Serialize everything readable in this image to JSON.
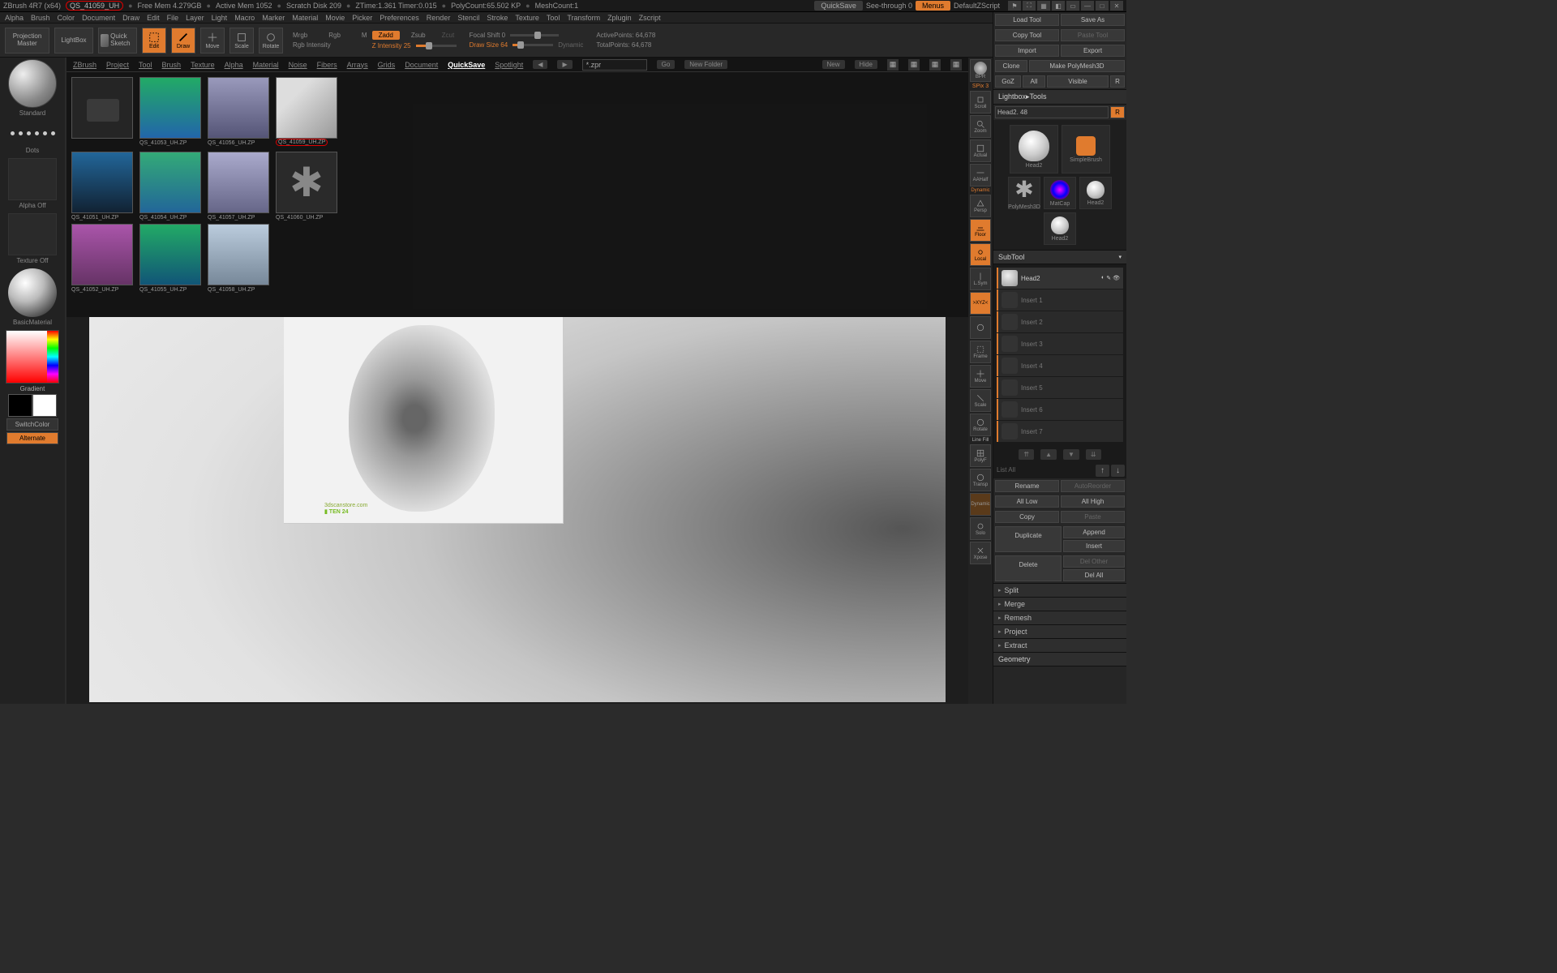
{
  "titlebar": {
    "app": "ZBrush 4R7 (x64)",
    "file": "QS_41059_UH",
    "freemem": "Free Mem 4.279GB",
    "activemem": "Active Mem 1052",
    "scratch": "Scratch Disk 209",
    "ztime": "ZTime:1.361 Timer:0.015",
    "polycount": "PolyCount:65.502 KP",
    "meshcount": "MeshCount:1",
    "quicksave": "QuickSave",
    "seethrough": "See-through   0",
    "menus": "Menus",
    "script": "DefaultZScript"
  },
  "topmenu": [
    "Alpha",
    "Brush",
    "Color",
    "Document",
    "Draw",
    "Edit",
    "File",
    "Layer",
    "Light",
    "Macro",
    "Marker",
    "Material",
    "Movie",
    "Picker",
    "Preferences",
    "Render",
    "Stencil",
    "Stroke",
    "Texture",
    "Tool",
    "Transform",
    "Zplugin",
    "Zscript"
  ],
  "toolbar": {
    "projection": "Projection Master",
    "lightbox": "LightBox",
    "quicksketch": "Quick Sketch",
    "edit": "Edit",
    "draw": "Draw",
    "move": "Move",
    "scale": "Scale",
    "rotate": "Rotate",
    "mrgb": "Mrgb",
    "rgb": "Rgb",
    "m": "M",
    "rgbintensity": "Rgb Intensity",
    "zadd": "Zadd",
    "zsub": "Zsub",
    "zcut": "Zcut",
    "zintensity": "Z Intensity 25",
    "focal": "Focal Shift 0",
    "drawsize": "Draw Size 64",
    "dynamic": "Dynamic",
    "activepoints": "ActivePoints: 64,678",
    "totalpoints": "TotalPoints: 64,678"
  },
  "leftrail": {
    "standard": "Standard",
    "dots": "Dots",
    "alpha": "Alpha Off",
    "texture": "Texture Off",
    "material": "BasicMaterial",
    "gradient": "Gradient",
    "switchcolor": "SwitchColor",
    "alternate": "Alternate"
  },
  "browser": {
    "tabs": [
      "ZBrush",
      "Project",
      "Tool",
      "Brush",
      "Texture",
      "Alpha",
      "Material",
      "Noise",
      "Fibers",
      "Arrays",
      "Grids",
      "Document",
      "QuickSave",
      "Spotlight"
    ],
    "active": "QuickSave",
    "search": "*.zpr",
    "go": "Go",
    "newfolder": "New Folder",
    "new": "New",
    "hide": "Hide",
    "thumbs": [
      {
        "label": "",
        "kind": "folder"
      },
      {
        "label": "QS_41053_UH.ZP",
        "kind": "body1"
      },
      {
        "label": "QS_41056_UH.ZP",
        "kind": "body2"
      },
      {
        "label": "QS_41059_UH.ZP",
        "kind": "hand",
        "circled": true
      },
      {
        "label": "QS_41051_UH.ZP",
        "kind": "body3"
      },
      {
        "label": "QS_41054_UH.ZP",
        "kind": "body4"
      },
      {
        "label": "QS_41057_UH.ZP",
        "kind": "body5"
      },
      {
        "label": "QS_41060_UH.ZP",
        "kind": "star"
      },
      {
        "label": "QS_41052_UH.ZP",
        "kind": "body6"
      },
      {
        "label": "QS_41055_UH.ZP",
        "kind": "body7"
      },
      {
        "label": "QS_41058_UH.ZP",
        "kind": "body8"
      }
    ]
  },
  "rightrail": {
    "bpr": "BPR",
    "spix": "SPix 3",
    "scroll": "Scroll",
    "zoom": "Zoom",
    "actual": "Actual",
    "aahalf": "AAHalf",
    "persp": "Persp",
    "floor": "Floor",
    "local": "Local",
    "lsym": "L.Sym",
    "xyz": ">XYZ<",
    "frame": "Frame",
    "move": "Move",
    "scale": "Scale",
    "rotate": "Rotate",
    "linefill": "Line Fill",
    "polyf": "PolyF",
    "transp": "Transp",
    "dynamic": "Dynamic",
    "solo": "Solo",
    "xpose": "Xpose"
  },
  "rightpanel": {
    "load": "Load Tool",
    "save": "Save As",
    "copy": "Copy Tool",
    "paste": "Paste Tool",
    "import": "Import",
    "export": "Export",
    "clone": "Clone",
    "polymesh": "Make PolyMesh3D",
    "goz": "GoZ",
    "all": "All",
    "visible": "Visible",
    "r": "R",
    "lightboxtools": "Lightbox▸Tools",
    "toolname": "Head2. 48",
    "tools": [
      {
        "l": "Head2"
      },
      {
        "l": "SimpleBrush"
      },
      {
        "l": "PolyMesh3D"
      },
      {
        "l": "MatCap"
      },
      {
        "l": "Head2"
      },
      {
        "l": "Head2"
      }
    ],
    "subtool": "SubTool",
    "subtoolname": "Head2",
    "subtools": [
      "Insert 1",
      "Insert 2",
      "Insert 3",
      "Insert 4",
      "Insert 5",
      "Insert 6",
      "Insert 7"
    ],
    "listall": "List All",
    "rename": "Rename",
    "autoreorder": "AutoReorder",
    "alllow": "All Low",
    "allhigh": "All High",
    "copy2": "Copy",
    "paste2": "Paste",
    "duplicate": "Duplicate",
    "append": "Append",
    "insert": "Insert",
    "delother": "Del Other",
    "delete": "Delete",
    "delall": "Del All",
    "sections": [
      "Split",
      "Merge",
      "Remesh",
      "Project",
      "Extract"
    ],
    "geometry": "Geometry"
  }
}
